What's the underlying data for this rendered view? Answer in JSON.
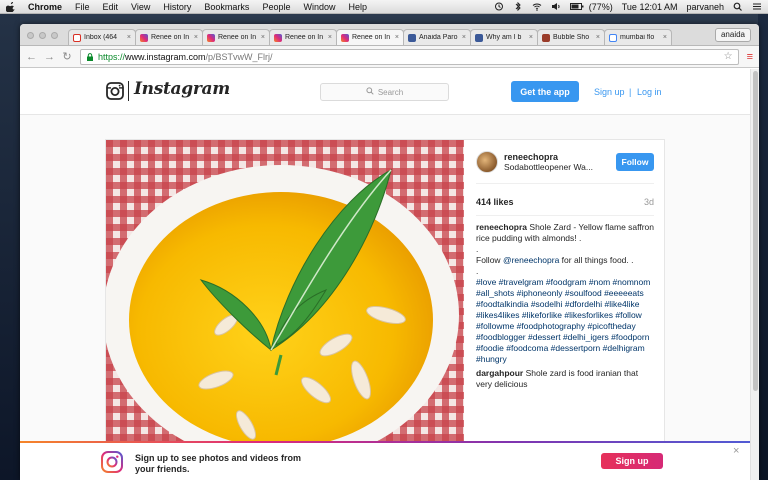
{
  "menubar": {
    "app": "Chrome",
    "items": [
      "File",
      "Edit",
      "View",
      "History",
      "Bookmarks",
      "People",
      "Window",
      "Help"
    ],
    "battery": "(77%)",
    "clock": "Tue 12:01 AM",
    "user": "parvaneh"
  },
  "browser": {
    "tabs": [
      {
        "label": "Inbox (464",
        "favicon_color": "#d93025",
        "icon": "gmail-icon"
      },
      {
        "label": "Renee on In",
        "favicon_color": "#c13584",
        "icon": "instagram-icon"
      },
      {
        "label": "Renee on In",
        "favicon_color": "#c13584",
        "icon": "instagram-icon"
      },
      {
        "label": "Renee on In",
        "favicon_color": "#c13584",
        "icon": "instagram-icon"
      },
      {
        "label": "Renee on In",
        "favicon_color": "#c13584",
        "icon": "instagram-icon"
      },
      {
        "label": "Anaida Paro",
        "favicon_color": "#3b5998",
        "icon": "facebook-icon"
      },
      {
        "label": "Why am I b",
        "favicon_color": "#3b5998",
        "icon": "facebook-icon"
      },
      {
        "label": "Bubble Sho",
        "favicon_color": "#9a3c2a",
        "icon": "site-icon"
      },
      {
        "label": "mumbai flo",
        "favicon_color": "#4285f4",
        "icon": "google-icon"
      }
    ],
    "profile": "anaida",
    "url_scheme": "https://",
    "url_host": "www.instagram.com",
    "url_path": "/p/BSTvwW_Flrj/"
  },
  "header": {
    "wordmark": "Instagram",
    "search_placeholder": "Search",
    "get_app": "Get the app",
    "sign_up": "Sign up",
    "separator": "|",
    "log_in": "Log in"
  },
  "post": {
    "username": "reneechopra",
    "location": "Sodabottleopener Wa...",
    "follow": "Follow",
    "likes": "414 likes",
    "time": "3d",
    "caption_user": "reneechopra",
    "caption_text": "Shole Zard - Yellow flame saffron rice pudding with almonds! .",
    "caption_dot1": ".",
    "caption_follow_prefix": "Follow ",
    "caption_mention": "@reneechopra",
    "caption_follow_suffix": " for all things food. .",
    "caption_dot2": ".",
    "hashtags": "#love #travelgram #foodgram #nom #nomnom #all_shots #iphoneonly #soulfood #eeeeeats #foodtalkindia #sodelhi #dfordelhi #like4like #likes4likes #likeforlike #likesforlikes #follow #followme #foodphotography #picoftheday #foodblogger #dessert #delhi_igers #foodporn #foodie #foodcoma #dessertporn #delhigram #hungry",
    "comment_user": "dargahpour",
    "comment_text": "Shole zard is food iranian that very delicious"
  },
  "banner": {
    "text": "Sign up to see photos and videos from your friends.",
    "sign_up": "Sign up",
    "close": "×"
  },
  "colors": {
    "accent_blue": "#3897f0",
    "banner_button": "#d62976"
  }
}
